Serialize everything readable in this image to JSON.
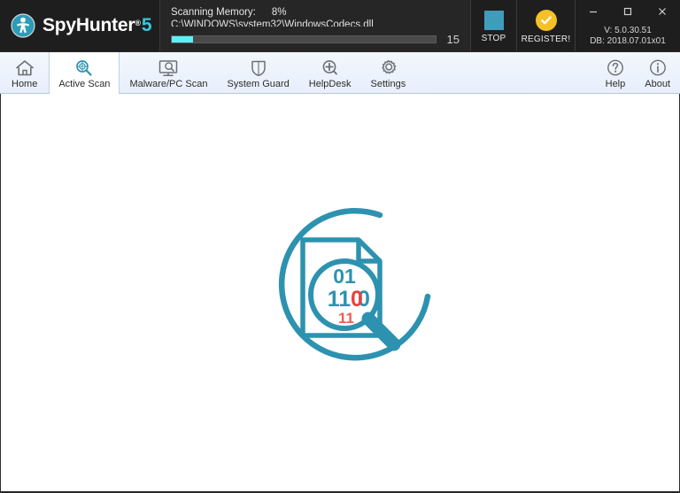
{
  "app": {
    "brand_name": "SpyHunter",
    "brand_registered": "®",
    "brand_version_suffix": "5"
  },
  "header": {
    "status": {
      "label": "Scanning Memory:",
      "percent": "8%",
      "percent_value": 8,
      "path": "C:\\WINDOWS\\system32\\WindowsCodecs.dll",
      "detections_count": "15"
    },
    "actions": [
      {
        "label": "STOP",
        "icon": "stop-square-icon",
        "color": "#3f9cba"
      },
      {
        "label": "REGISTER!",
        "icon": "check-circle-icon",
        "color": "#f5c127"
      }
    ],
    "window_controls": [
      {
        "name": "minimize",
        "glyph": "minimize-icon"
      },
      {
        "name": "maximize",
        "glyph": "maximize-icon"
      },
      {
        "name": "close",
        "glyph": "close-icon"
      }
    ],
    "version": {
      "product": "V: 5.0.30.51",
      "database": "DB: 2018.07.01x01"
    }
  },
  "nav": {
    "items": [
      {
        "label": "Home",
        "icon": "home-icon",
        "active": false
      },
      {
        "label": "Active Scan",
        "icon": "magnifier-scan-icon",
        "active": true
      },
      {
        "label": "Malware/PC Scan",
        "icon": "monitor-scan-icon",
        "active": false
      },
      {
        "label": "System Guard",
        "icon": "shield-icon",
        "active": false
      },
      {
        "label": "HelpDesk",
        "icon": "plus-magnifier-icon",
        "active": false
      },
      {
        "label": "Settings",
        "icon": "gear-icon",
        "active": false
      }
    ],
    "right_items": [
      {
        "label": "Help",
        "icon": "question-circle-icon"
      },
      {
        "label": "About",
        "icon": "info-circle-icon"
      }
    ]
  },
  "main": {
    "illustration": {
      "name": "scanning-document-illustration",
      "accent_color": "#2d92b0",
      "highlight_color": "#e8413c",
      "binary_top": "01",
      "binary_mid": "1100",
      "binary_bottom": "11"
    }
  },
  "colors": {
    "header_bg": "#1e1e1e",
    "status_bg": "#262626",
    "accent_cyan": "#5ff0f5",
    "teal": "#3f9cba",
    "amber": "#f5c127",
    "nav_bg": "#eaf1fb"
  }
}
